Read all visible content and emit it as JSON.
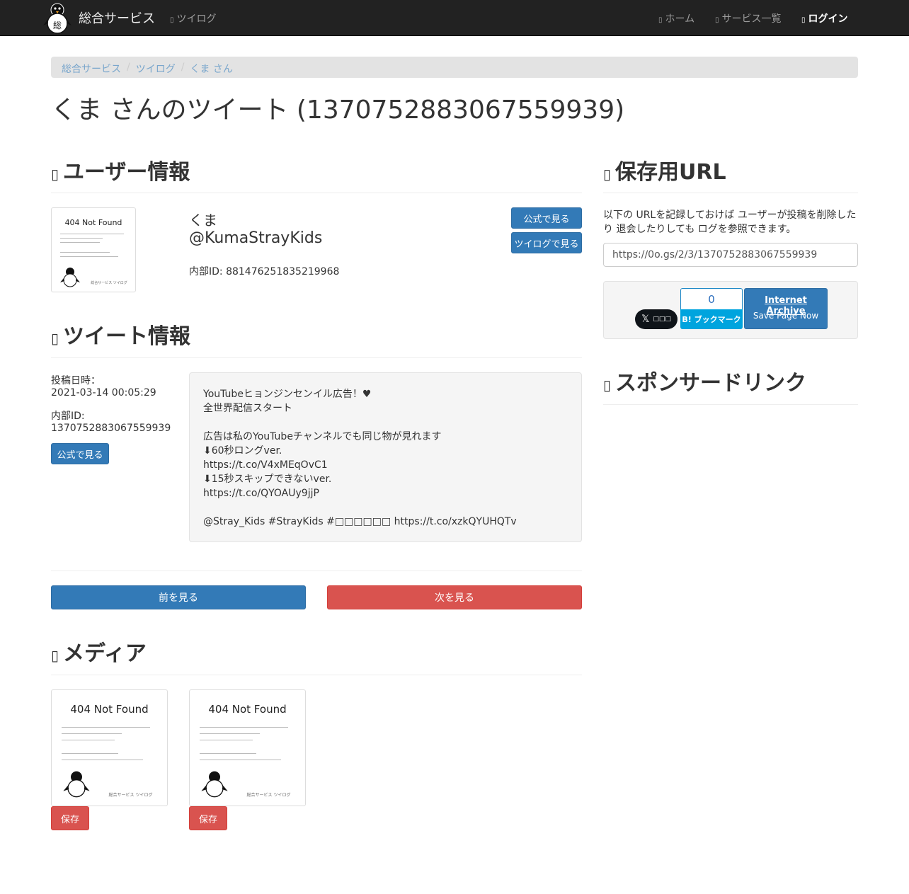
{
  "navbar": {
    "brand": "総合サービス",
    "tweilog": "ツイログ",
    "home": "ホーム",
    "services": "サービス一覧",
    "login": "ログイン"
  },
  "breadcrumb": [
    "総合サービス",
    "ツイログ",
    "くま さん"
  ],
  "page_title": "くま さんのツイート (1370752883067559939)",
  "user_section": {
    "heading": "ユーザー情報",
    "name": "くま",
    "handle": "@KumaStrayKids",
    "internal_id": "内部ID: 881476251835219968",
    "btn_official": "公式で見る",
    "btn_tweilog": "ツイログで見る"
  },
  "thumb_404": {
    "title": "404 Not Found",
    "footer": "総合サービス ツイログ"
  },
  "tweet_section": {
    "heading": "ツイート情報",
    "posted_label": "投稿日時：",
    "posted_value": "2021-03-14 00:05:29",
    "id_label": "内部ID:",
    "id_value": "1370752883067559939",
    "btn_official": "公式で見る",
    "text": "YouTubeヒョンジンセンイル広告！♥\n全世界配信スタート\n\n広告は私のYouTubeチャンネルでも同じ物が見れます\n⬇60秒ロングver.\nhttps://t.co/V4xMEqOvC1\n⬇15秒スキップできないver.\nhttps://t.co/QYOAUy9jjP\n\n@Stray_Kids #StrayKids #□□□□□□ https://t.co/xzkQYUHQTv"
  },
  "nav_buttons": {
    "prev": "前を見る",
    "next": "次を見る"
  },
  "media_section": {
    "heading": "メディア",
    "save_label": "保存"
  },
  "save_url_section": {
    "heading": "保存用URL",
    "description": "以下の URLを記録しておけば ユーザーが投稿を削除したり 退会したりしても ログを参照できます。",
    "url": "https://0o.gs/2/3/1370752883067559939"
  },
  "share": {
    "x_label": "□□□",
    "hatena_count": "0",
    "hatena_label": "B! ブックマーク",
    "ia_title": "Internet Archive",
    "ia_sub": "Save Page Now"
  },
  "sponsor_section": {
    "heading": "スポンサードリンク"
  },
  "icons": {
    "brand": "penguin-logo",
    "nav": "glyph-placeholder",
    "section": "glyph-placeholder"
  }
}
